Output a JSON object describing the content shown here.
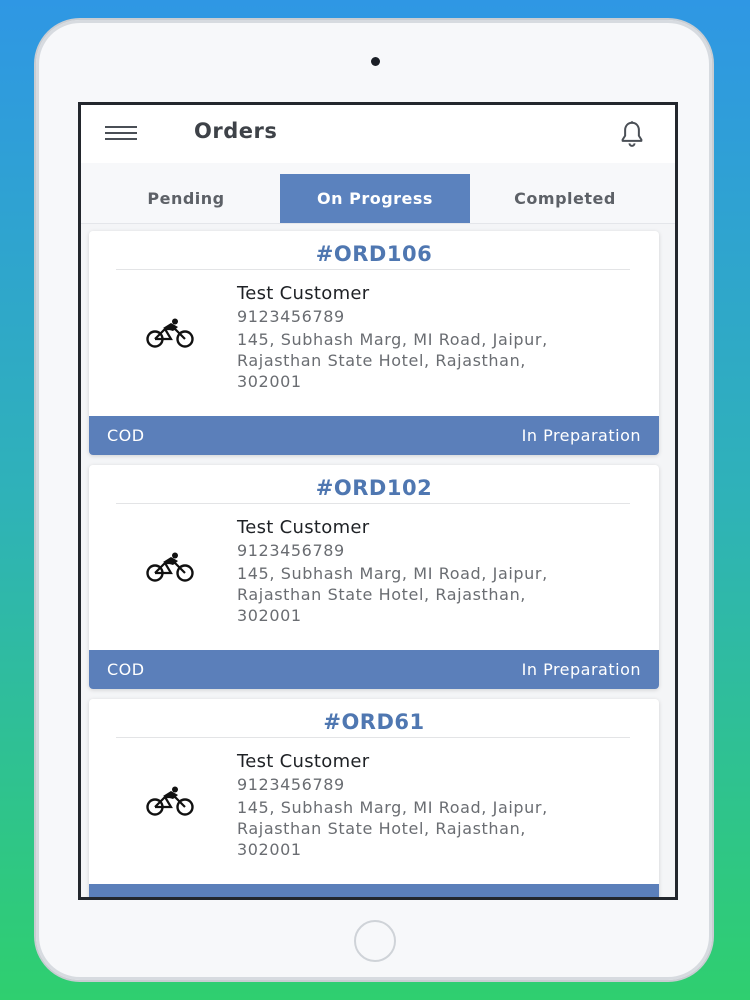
{
  "header": {
    "title": "Orders"
  },
  "tabs": [
    {
      "label": "Pending",
      "active": false
    },
    {
      "label": "On Progress",
      "active": true
    },
    {
      "label": "Completed",
      "active": false
    }
  ],
  "orders": [
    {
      "id": "#ORD106",
      "customer": "Test Customer",
      "phone": "9123456789",
      "address": "145, Subhash Marg, MI Road, Jaipur, Rajasthan State Hotel, Rajasthan, 302001",
      "payment": "COD",
      "status": "In Preparation",
      "icon": "bicycle-icon"
    },
    {
      "id": "#ORD102",
      "customer": "Test Customer",
      "phone": "9123456789",
      "address": "145, Subhash Marg, MI Road, Jaipur, Rajasthan State Hotel, Rajasthan, 302001",
      "payment": "COD",
      "status": "In Preparation",
      "icon": "bicycle-icon"
    },
    {
      "id": "#ORD61",
      "customer": "Test Customer",
      "phone": "9123456789",
      "address": "145, Subhash Marg, MI Road, Jaipur, Rajasthan State Hotel, Rajasthan, 302001",
      "payment": "",
      "status": "",
      "icon": "bicycle-icon"
    }
  ],
  "icons": {
    "menu": "menu-icon",
    "notifications": "bell-icon"
  },
  "colors": {
    "accent": "#5b82be",
    "order_id": "#4f77b1",
    "footer": "#5b7fba"
  }
}
